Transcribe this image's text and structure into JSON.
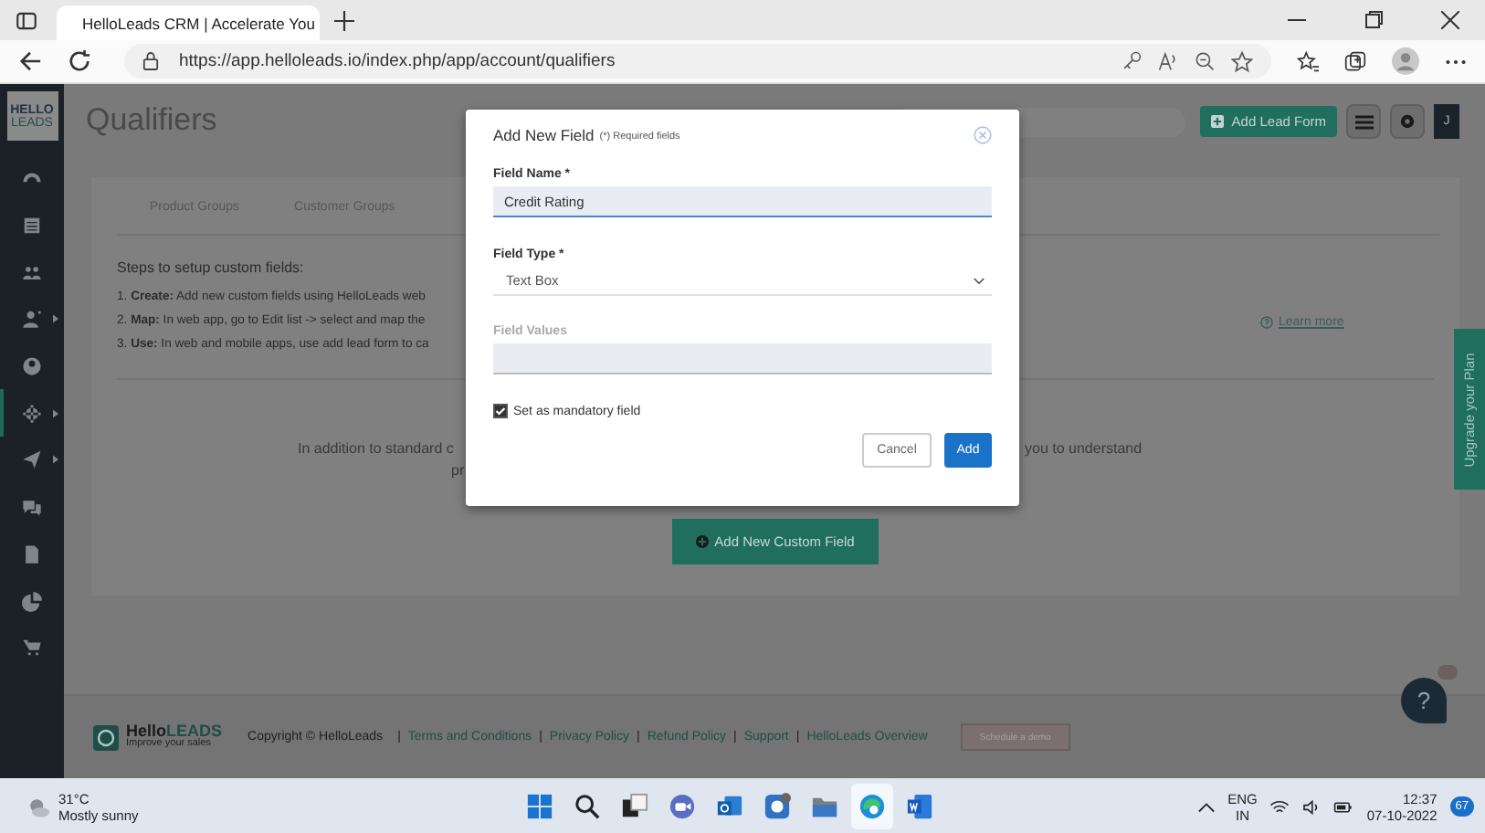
{
  "browser": {
    "tab_title": "HelloLeads CRM | Accelerate You",
    "url": "https://app.helloleads.io/index.php/app/account/qualifiers"
  },
  "sidebar": {
    "logo_top": "HELLO",
    "logo_bottom": "LEADS",
    "items": [
      {
        "selected": false,
        "submenu": false
      },
      {
        "selected": false,
        "submenu": false
      },
      {
        "selected": false,
        "submenu": false
      },
      {
        "selected": false,
        "submenu": true
      },
      {
        "selected": false,
        "submenu": false
      },
      {
        "selected": true,
        "submenu": true
      },
      {
        "selected": false,
        "submenu": true
      },
      {
        "selected": false,
        "submenu": false
      },
      {
        "selected": false,
        "submenu": false
      },
      {
        "selected": false,
        "submenu": false
      },
      {
        "selected": false,
        "submenu": false
      }
    ]
  },
  "header": {
    "title": "Qualifiers",
    "add_lead_form": "Add Lead Form",
    "avatar": "J"
  },
  "card": {
    "tabs": [
      "Product Groups",
      "Customer Groups"
    ],
    "steps_title": "Steps to setup custom fields:",
    "steps": [
      "1. **Create:** Add new custom fields using HelloLeads web",
      "2. **Map:** In web app, go to Edit list -> select and map the",
      "3. **Use:** In web and mobile apps, use add lead form to ca"
    ],
    "learn_more": "Learn more",
    "intro_left": "In addition to standard c",
    "intro_right": "you to understand",
    "intro_second": "pr",
    "add_button": "Add New Custom Field"
  },
  "upgrade": "Upgrade your Plan",
  "help": "?",
  "footer": {
    "brand_start": "Hello",
    "brand_end": "LEADS",
    "tagline": "Improve your sales",
    "copyright": "Copyright © HelloLeads",
    "separator": "|",
    "links": [
      "Terms and Conditions",
      "Privacy Policy",
      "Refund Policy",
      "Support",
      "HelloLeads Overview"
    ],
    "demo_button": "Schedule a demo"
  },
  "modal": {
    "title": "Add New Field",
    "required_note": "(*) Required fields",
    "field_name": {
      "label": "Field Name *",
      "value": "Credit Rating"
    },
    "field_type": {
      "label": "Field Type *",
      "value": "Text Box"
    },
    "field_values": {
      "label": "Field Values",
      "disabled": true
    },
    "mandatory": {
      "label": "Set as mandatory field",
      "checked": true
    },
    "cancel": "Cancel",
    "add": "Add"
  },
  "taskbar": {
    "temperature": "31°C",
    "weather": "Mostly sunny",
    "apps": [
      {
        "selected": false
      },
      {
        "selected": false
      },
      {
        "selected": false
      },
      {
        "selected": false
      },
      {
        "selected": false
      },
      {
        "selected": false
      },
      {
        "selected": false
      },
      {
        "selected": true
      },
      {
        "selected": false
      }
    ],
    "language": "ENG",
    "region": "IN",
    "time": "12:37",
    "date": "07-10-2022",
    "notifications": "67"
  }
}
